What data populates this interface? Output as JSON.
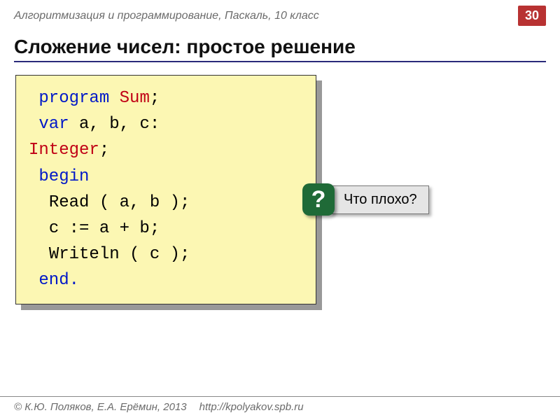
{
  "header": {
    "course": "Алгоритмизация и программирование, Паскаль, 10 класс",
    "page_number": "30"
  },
  "title": "Сложение чисел: простое решение",
  "code": {
    "l1_kw": "program",
    "l1_name": "Sum",
    "semi": ";",
    "l2_var": "var",
    "l2_decl": " a, b, c: ",
    "l3_type": "Integer",
    "l3_semi": ";",
    "l4": "begin",
    "l5": "Read ( a, b );",
    "l6": "c := a + b;",
    "l7": "Writeln ( c );",
    "l8": "end."
  },
  "callout": {
    "mark": "?",
    "text": "Что плохо?"
  },
  "footer": {
    "authors": "© К.Ю. Поляков, Е.А. Ерёмин, 2013",
    "url": "http://kpolyakov.spb.ru"
  }
}
